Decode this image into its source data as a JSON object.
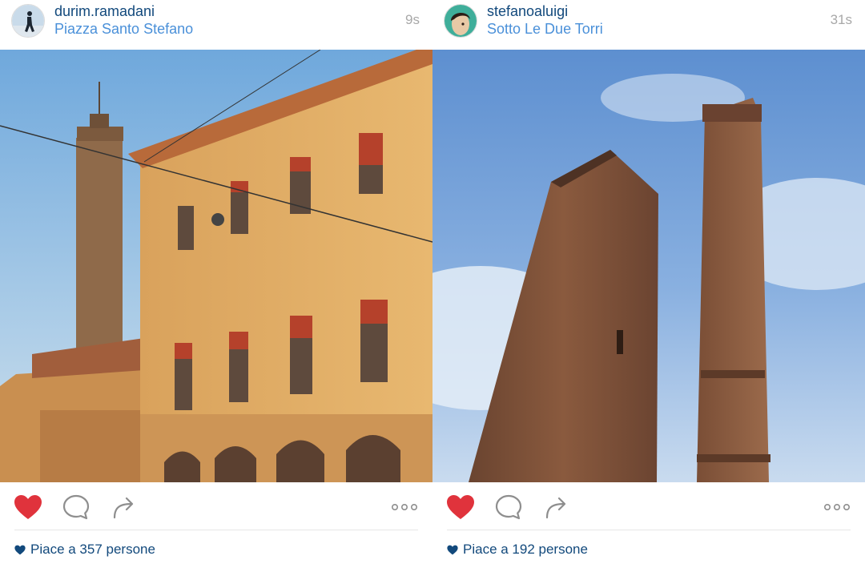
{
  "posts": [
    {
      "username": "durim.ramadani",
      "location": "Piazza Santo Stefano",
      "time_ago": "9s",
      "likes_text": "Piace a 357 persone",
      "liked": true,
      "avatar_icon": "runner-silhouette-avatar",
      "photo_subject": "tower-and-palazzo"
    },
    {
      "username": "stefanoaluigi",
      "location": "Sotto Le Due Torri",
      "time_ago": "31s",
      "likes_text": "Piace a 192 persone",
      "liked": true,
      "avatar_icon": "face-avatar",
      "photo_subject": "two-towers"
    }
  ],
  "colors": {
    "username": "#12497c",
    "location": "#4a90d9",
    "time": "#a8a8a8",
    "heart_liked": "#e0333c",
    "icon_gray": "#8e8e8e",
    "divider": "#e6e6e6"
  }
}
